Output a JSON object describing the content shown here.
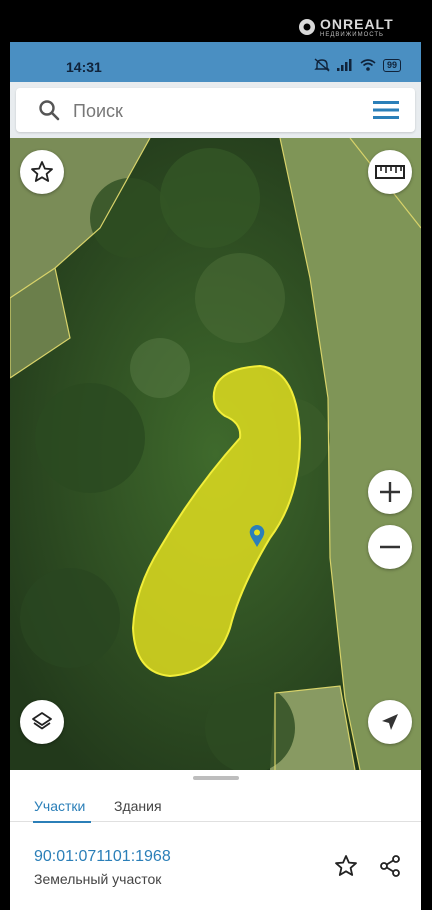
{
  "watermark": {
    "text": "ONREALT",
    "sub": "НЕДВИЖИМОСТЬ"
  },
  "status": {
    "time": "14:31",
    "battery": "99"
  },
  "search": {
    "placeholder": "Поиск"
  },
  "tabs": [
    {
      "label": "Участки",
      "active": true
    },
    {
      "label": "Здания",
      "active": false
    }
  ],
  "parcel": {
    "id": "90:01:071101:1968",
    "type": "Земельный участок"
  },
  "colors": {
    "accent": "#2b7fb8",
    "parcel_fill": "#e5e21f",
    "statusbar": "#4a8fc2"
  },
  "icons": {
    "favorite": "star-icon",
    "ruler": "ruler-icon",
    "zoom_in": "plus-icon",
    "zoom_out": "minus-icon",
    "layers": "layers-icon",
    "location": "navigation-arrow-icon",
    "share": "share-icon",
    "menu": "hamburger-menu-icon",
    "search": "search-icon"
  }
}
